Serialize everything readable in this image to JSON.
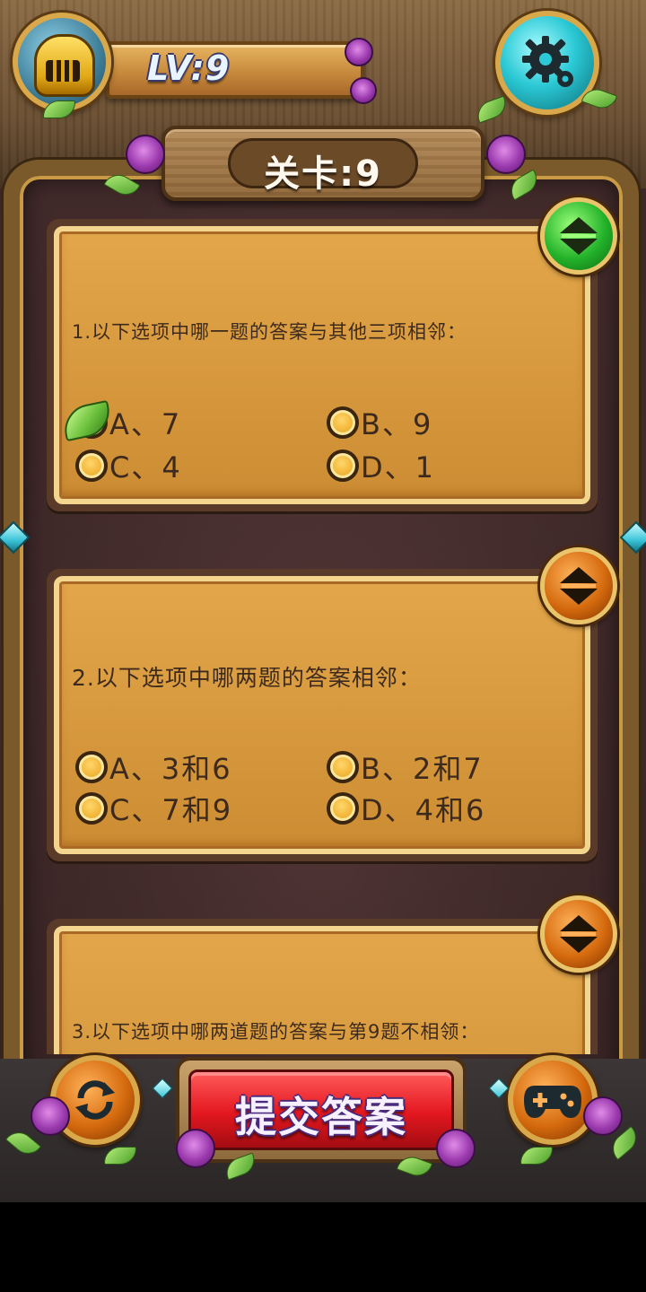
{
  "header": {
    "level_label": "LV:9",
    "stage_label": "关卡:9"
  },
  "questions": [
    {
      "text": "1.以下选项中哪一题的答案与其他三项相邻：",
      "options": [
        {
          "label": "A、7",
          "selected": true
        },
        {
          "label": "B、9",
          "selected": false
        },
        {
          "label": "C、4",
          "selected": false
        },
        {
          "label": "D、1",
          "selected": false
        }
      ],
      "toggle_color": "green"
    },
    {
      "text": "2.以下选项中哪两题的答案相邻：",
      "options": [
        {
          "label": "A、3和6",
          "selected": false
        },
        {
          "label": "B、2和7",
          "selected": false
        },
        {
          "label": "C、7和9",
          "selected": false
        },
        {
          "label": "D、4和6",
          "selected": false
        }
      ],
      "toggle_color": "orange"
    },
    {
      "text": "3.以下选项中哪两道题的答案与第9题不相领：",
      "toggle_color": "orange"
    }
  ],
  "footer": {
    "submit_label": "提交答案"
  },
  "icons": {
    "avatar": "knight-helmet-icon",
    "settings": "gear-icon",
    "toggle": "expand-collapse-arrows-icon",
    "refresh": "refresh-icon",
    "game": "gamepad-icon"
  },
  "colors": {
    "card": "#d89a3e",
    "submit": "#e3171f",
    "toggle_green": "#23b22a",
    "toggle_orange": "#d56a0e",
    "gem": "#3cc4d8"
  }
}
